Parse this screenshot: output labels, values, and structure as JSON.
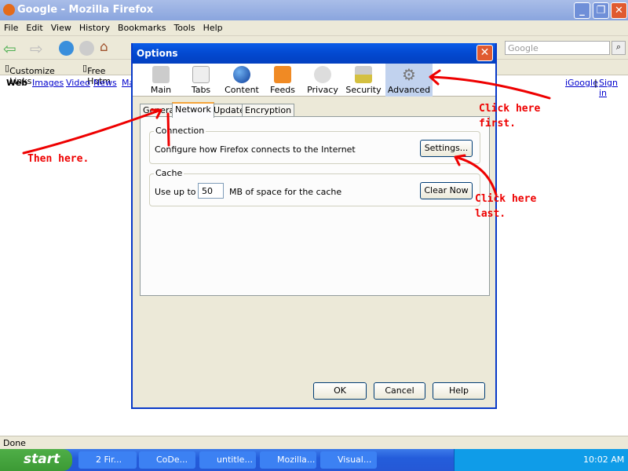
{
  "window": {
    "title": "Google - Mozilla Firefox"
  },
  "menu": [
    "File",
    "Edit",
    "View",
    "History",
    "Bookmarks",
    "Tools",
    "Help"
  ],
  "search": {
    "placeholder": "Google"
  },
  "bookmarks": [
    "Customize Links",
    "Free Hotm"
  ],
  "google_links": {
    "web": "Web",
    "items": [
      "Images",
      "Video",
      "News",
      "Ma"
    ],
    "igoogle": "iGoogle",
    "separator": "|",
    "signin": "Sign in"
  },
  "status": "Done",
  "taskbar": {
    "start": "start",
    "tasks": [
      "2 Fir...",
      "CoDe...",
      "untitle...",
      "Mozilla...",
      "Visual..."
    ],
    "clock": "10:02 AM"
  },
  "dialog": {
    "title": "Options",
    "panes": [
      {
        "label": "Main",
        "icon": "main-icon"
      },
      {
        "label": "Tabs",
        "icon": "tabs-icon"
      },
      {
        "label": "Content",
        "icon": "globe-icon"
      },
      {
        "label": "Feeds",
        "icon": "rss-icon"
      },
      {
        "label": "Privacy",
        "icon": "privacy-icon"
      },
      {
        "label": "Security",
        "icon": "lock-icon"
      },
      {
        "label": "Advanced",
        "icon": "gear-icon",
        "selected": true
      }
    ],
    "tabs": [
      "General",
      "Network",
      "Update",
      "Encryption"
    ],
    "selected_tab": "Network",
    "connection": {
      "legend": "Connection",
      "text": "Configure how Firefox connects to the Internet",
      "button": "Settings..."
    },
    "cache": {
      "legend": "Cache",
      "prefix": "Use up to",
      "value": "50",
      "suffix": "MB of space for the cache",
      "button": "Clear Now"
    },
    "buttons": {
      "ok": "OK",
      "cancel": "Cancel",
      "help": "Help"
    }
  },
  "annotations": {
    "first": "Click here first.",
    "then": "Then here.",
    "last": "Click here last.",
    "color": "#e00000"
  }
}
